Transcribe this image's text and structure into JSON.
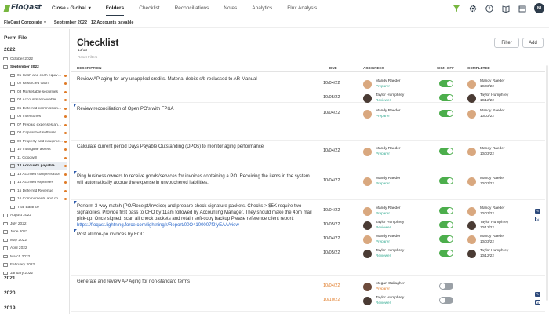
{
  "top_nav": {
    "logo": "FloQast",
    "close_select": "Close - Global",
    "links": [
      "Folders",
      "Checklist",
      "Reconciliations",
      "Notes",
      "Analytics",
      "Flux Analysis"
    ],
    "active": "Folders",
    "avatar_initials": "NI"
  },
  "sub_bar": {
    "entity": "FloQast Corporate",
    "breadcrumb": "September 2022 : 12 Accounts payable"
  },
  "sidebar": {
    "title": "Perm File",
    "years": [
      "2022",
      "2021",
      "2020",
      "2019"
    ],
    "months_2022": [
      "October 2022",
      "September 2022",
      "August 2022",
      "July 2022",
      "June 2022",
      "May 2022",
      "April 2022",
      "March 2022",
      "February 2022",
      "January 2022"
    ],
    "folders": [
      {
        "label": "01 Cash and cash equival...",
        "dot": "#e07a26"
      },
      {
        "label": "02 Restricted cash",
        "dot": "#e07a26"
      },
      {
        "label": "03 Marketable securities",
        "dot": "#e07a26"
      },
      {
        "label": "04 Accounts receivable",
        "dot": "#e07a26"
      },
      {
        "label": "05 Deferred commission...",
        "dot": "#e07a26"
      },
      {
        "label": "06 Inventories",
        "dot": "#e07a26"
      },
      {
        "label": "07 Prepaid expenses and...",
        "dot": "#e07a26"
      },
      {
        "label": "08 Capitalized software",
        "dot": "#e07a26"
      },
      {
        "label": "09 Property and equipme...",
        "dot": "#e07a26"
      },
      {
        "label": "10 Intangible assets",
        "dot": "#e07a26"
      },
      {
        "label": "11 Goodwill",
        "dot": "#e07a26"
      },
      {
        "label": "12 Accounts payable",
        "dot": "#e07a26"
      },
      {
        "label": "13 Accrued compensation",
        "dot": "#e07a26"
      },
      {
        "label": "14 Accrued expenses",
        "dot": "#e07a26"
      },
      {
        "label": "15 Deferred Revenue",
        "dot": "#e07a26"
      },
      {
        "label": "16 Commitments and co...",
        "dot": "#e07a26"
      },
      {
        "label": "Trial Balance",
        "dot": ""
      }
    ]
  },
  "main": {
    "title": "Checklist",
    "count": "13/13",
    "reset_filters": "Reset Filters",
    "filter_button": "Filter",
    "add_button": "Add",
    "columns": {
      "description": "DESCRIPTION",
      "due": "DUE",
      "assignees": "ASSIGNEES",
      "signoff": "SIGN-OFF",
      "completed": "COMPLETED"
    }
  },
  "rows": [
    {
      "description": "Review AP aging for any unapplied credits. Material debits s/b reclassed to AR-Manual",
      "link": "",
      "flag": false,
      "signoffs": [
        {
          "due": "10/04/22",
          "due_late": false,
          "assignee": "Mandy Raeder",
          "role": "Preparer",
          "role_overdue": false,
          "avatar": "f",
          "signed": true,
          "completed_by": "Mandy Raeder",
          "completed_date": "10/03/22",
          "completed_late": false
        },
        {
          "due": "10/05/22",
          "due_late": false,
          "assignee": "Taylor Humphrey",
          "role": "Reviewer",
          "role_overdue": false,
          "avatar": "m",
          "signed": true,
          "completed_by": "Taylor Humphrey",
          "completed_date": "10/12/22",
          "completed_late": true
        }
      ]
    },
    {
      "description": "Review reconciliation of Open PO's with FP&A",
      "link": "",
      "flag": true,
      "signoffs": [
        {
          "due": "10/04/22",
          "due_late": false,
          "assignee": "Mandy Raeder",
          "role": "Preparer",
          "role_overdue": false,
          "avatar": "f",
          "signed": true,
          "completed_by": "Mandy Raeder",
          "completed_date": "10/03/22",
          "completed_late": false
        }
      ]
    },
    {
      "description": "Calculate current period Days Payable Outstanding (DPOs) to monitor aging performance",
      "link": "",
      "flag": false,
      "signoffs": [
        {
          "due": "10/04/22",
          "due_late": false,
          "assignee": "Mandy Raeder",
          "role": "Preparer",
          "role_overdue": false,
          "avatar": "f",
          "signed": true,
          "completed_by": "Mandy Raeder",
          "completed_date": "10/03/22",
          "completed_late": false
        }
      ]
    },
    {
      "description": "Ping business owners to receive goods/services for invoices containing a PO. Receiving the items in the system will automatically accrue the expense in unvouchered liabilities.",
      "link": "",
      "flag": true,
      "signoffs": [
        {
          "due": "10/04/22",
          "due_late": false,
          "assignee": "Mandy Raeder",
          "role": "Preparer",
          "role_overdue": false,
          "avatar": "f",
          "signed": true,
          "completed_by": "Mandy Raeder",
          "completed_date": "10/03/22",
          "completed_late": false
        }
      ]
    },
    {
      "description": "Perform 3-way match (PO/Receipt/Invoice) and prepare check signature packets. Checks > $5K require two signatories. Provide first pass to CFO by 11am followed by Accounting Manager. They should make the 4pm mail pick-up. Once signed, scan all check packets and retain soft-copy backup Please reference client report:",
      "link": "https://floqast.lightning.force.com/lightning/r/Report/00O4100007f2fyEAA/view",
      "flag": true,
      "signoffs": [
        {
          "due": "10/04/22",
          "due_late": false,
          "assignee": "Mandy Raeder",
          "role": "Preparer",
          "role_overdue": false,
          "avatar": "f",
          "signed": true,
          "completed_by": "Mandy Raeder",
          "completed_date": "10/03/22",
          "completed_late": false
        },
        {
          "due": "10/05/22",
          "due_late": false,
          "assignee": "Taylor Humphrey",
          "role": "Reviewer",
          "role_overdue": false,
          "avatar": "m",
          "signed": true,
          "completed_by": "Taylor Humphrey",
          "completed_date": "10/12/22",
          "completed_late": true
        }
      ]
    },
    {
      "description": "Post all non-po invoices by EOD",
      "link": "",
      "flag": true,
      "signoffs": [
        {
          "due": "10/04/22",
          "due_late": false,
          "assignee": "Mandy Raeder",
          "role": "Preparer",
          "role_overdue": false,
          "avatar": "f",
          "signed": true,
          "completed_by": "Mandy Raeder",
          "completed_date": "10/03/22",
          "completed_late": false
        },
        {
          "due": "10/05/22",
          "due_late": false,
          "assignee": "Taylor Humphrey",
          "role": "Reviewer",
          "role_overdue": false,
          "avatar": "m",
          "signed": true,
          "completed_by": "Taylor Humphrey",
          "completed_date": "10/12/22",
          "completed_late": true
        }
      ]
    },
    {
      "description": "Generate and review AP Aging for non-standard terms",
      "link": "",
      "flag": false,
      "signoffs": [
        {
          "due": "10/04/22",
          "due_late": true,
          "assignee": "Megan Gallagher",
          "role": "Preparer",
          "role_overdue": true,
          "avatar": "g",
          "signed": false,
          "completed_by": "",
          "completed_date": "",
          "completed_late": false
        },
        {
          "due": "10/10/22",
          "due_late": true,
          "assignee": "Taylor Humphrey",
          "role": "Reviewer",
          "role_overdue": false,
          "avatar": "m",
          "signed": false,
          "completed_by": "",
          "completed_date": "",
          "completed_late": false
        }
      ]
    }
  ],
  "colors": {
    "accent_green": "#4cae4c",
    "navy": "#2d3b4a",
    "overdue_orange": "#e07a26",
    "role_teal": "#2fa98f",
    "link_blue": "#2a67c9"
  }
}
